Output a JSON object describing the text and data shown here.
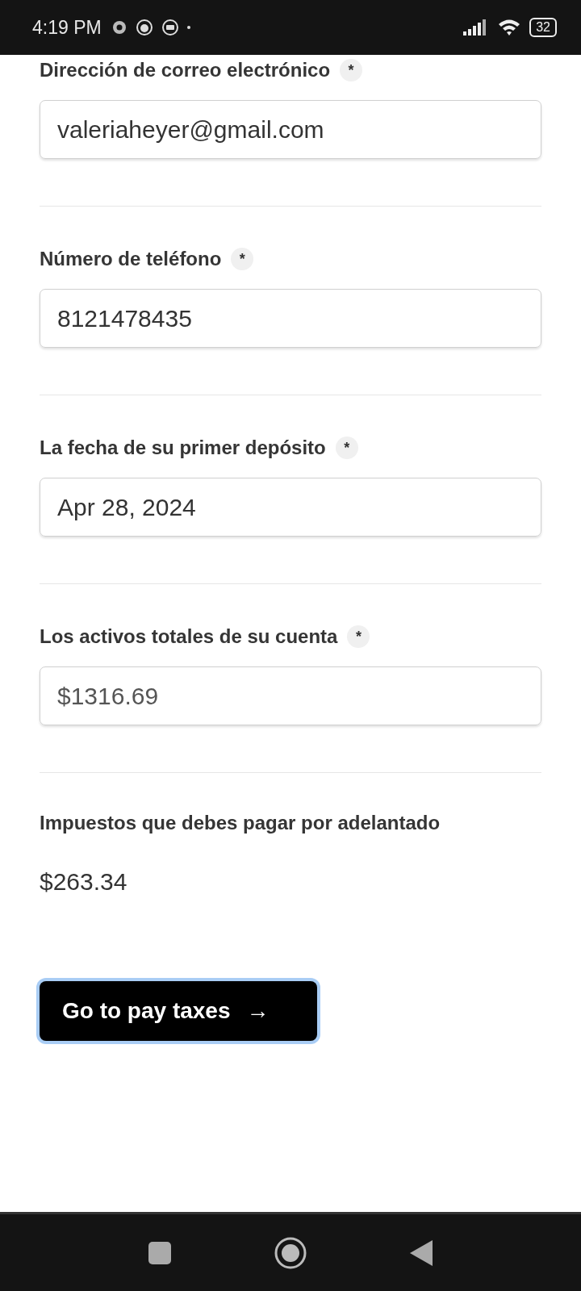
{
  "status_bar": {
    "time": "4:19 PM",
    "battery": "32"
  },
  "fields": [
    {
      "label": "Dirección de correo electrónico",
      "required_mark": "*",
      "value": "valeriaheyer@gmail.com",
      "disabled": false
    },
    {
      "label": "Número de teléfono",
      "required_mark": "*",
      "value": "8121478435",
      "disabled": false
    },
    {
      "label": "La fecha de su primer depósito",
      "required_mark": "*",
      "value": "Apr 28, 2024",
      "disabled": false
    },
    {
      "label": "Los activos totales de su cuenta",
      "required_mark": "*",
      "value": "$1316.69",
      "disabled": true
    }
  ],
  "tax": {
    "label": "Impuestos que debes pagar por adelantado",
    "value": "$263.34"
  },
  "button": {
    "label": "Go to pay taxes",
    "icon": "→",
    "focused": true
  }
}
